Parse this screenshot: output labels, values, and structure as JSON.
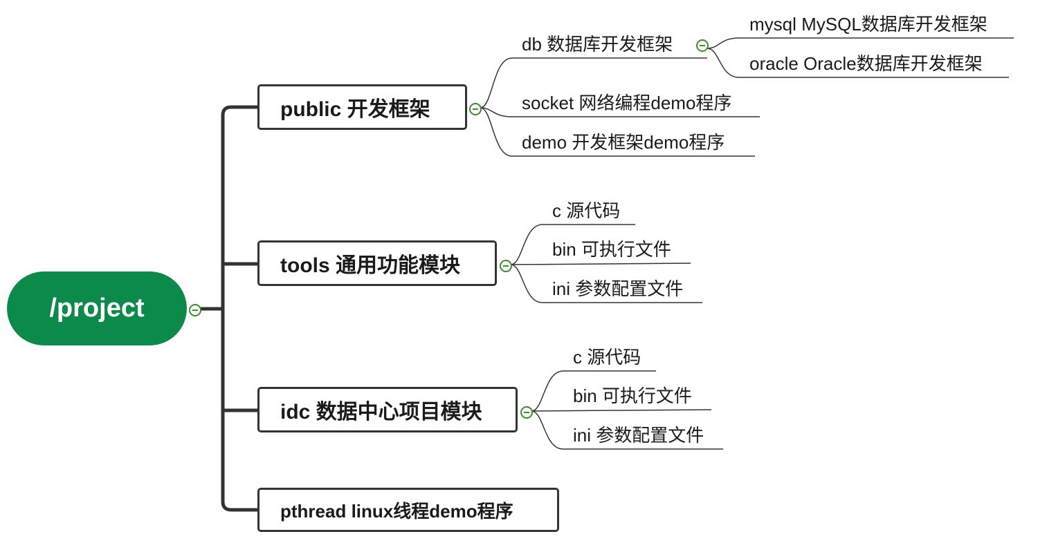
{
  "root": {
    "label": "/project"
  },
  "branches": {
    "public": {
      "label": "public 开发框架",
      "children": {
        "db": {
          "label": "db 数据库开发框架",
          "children": {
            "mysql": "mysql MySQL数据库开发框架",
            "oracle": "oracle Oracle数据库开发框架"
          }
        },
        "socket": "socket 网络编程demo程序",
        "demo": "demo 开发框架demo程序"
      }
    },
    "tools": {
      "label": "tools 通用功能模块",
      "children": [
        "c 源代码",
        "bin 可执行文件",
        "ini 参数配置文件"
      ]
    },
    "idc": {
      "label": "idc 数据中心项目模块",
      "children": [
        "c 源代码",
        "bin 可执行文件",
        "ini 参数配置文件"
      ]
    },
    "pthread": {
      "label": "pthread linux线程demo程序"
    }
  },
  "colors": {
    "root_fill": "#0c8a4a",
    "connector": "#333333",
    "toggle": "#3b8c2a"
  },
  "icons": {
    "collapse": "collapse-minus-icon"
  }
}
